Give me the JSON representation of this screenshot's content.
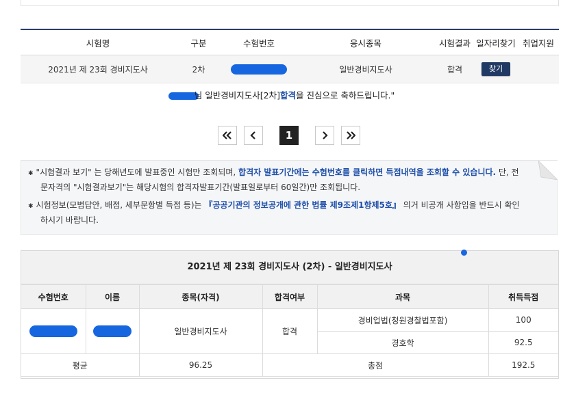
{
  "results_table": {
    "headers": [
      "시험명",
      "구분",
      "수험번호",
      "응시종목",
      "시험결과",
      "일자리찾기",
      "취업지원"
    ],
    "row": {
      "exam_name": "2021년 제 23회 경비지도사",
      "stage": "2차",
      "category": "일반경비지도사",
      "result": "합격",
      "find_button": "찾기"
    }
  },
  "congrats": {
    "suffix_name": "님",
    "pre": "일반경비지도사[2차]",
    "pass": "합격",
    "post": "을 진심으로 축하드립니다.\""
  },
  "pagination": {
    "first_icon": "double-chevron-left-icon",
    "prev_icon": "chevron-left-icon",
    "current_page": "1",
    "next_icon": "chevron-right-icon",
    "last_icon": "double-chevron-right-icon"
  },
  "notice": {
    "line1_a": "\"시험결과 보기\" 는 당해년도에 발표중인 시험만 조회되며, ",
    "line1_hl": "합격자 발표기간에는 수험번호를 클릭하면 득점내역을 조회할 수 있습니다.",
    "line1_b": " 단, 전",
    "line2": "문자격의 \"시험결과보기\"는 해당시험의 합격자발표기간(발표일로부터 60일간)만 조회됩니다.",
    "line3_a": "시험정보(모범답안, 배점, 세부문항별 득점 등)는 ",
    "line3_hl": "『공공기관의 정보공개에 관한 법률 제9조제1항제5호』",
    "line3_b": " 의거 비공개 사항임을 반드시 확인",
    "line4": "하시기 바랍니다."
  },
  "score": {
    "title": "2021년 제 23회 경비지도사 (2차) - 일반경비지도사",
    "headers": [
      "수험번호",
      "이름",
      "종목(자격)",
      "합격여부",
      "과목",
      "취득득점"
    ],
    "category": "일반경비지도사",
    "result": "합격",
    "subjects": [
      {
        "name": "경비업법(청원경찰법포함)",
        "score": "100"
      },
      {
        "name": "경호학",
        "score": "92.5"
      }
    ],
    "average_label": "평균",
    "average_value": "96.25",
    "total_label": "총점",
    "total_value": "192.5"
  },
  "colors": {
    "accent": "#1d4ea8",
    "button": "#213a63",
    "redaction": "#1666e0"
  }
}
